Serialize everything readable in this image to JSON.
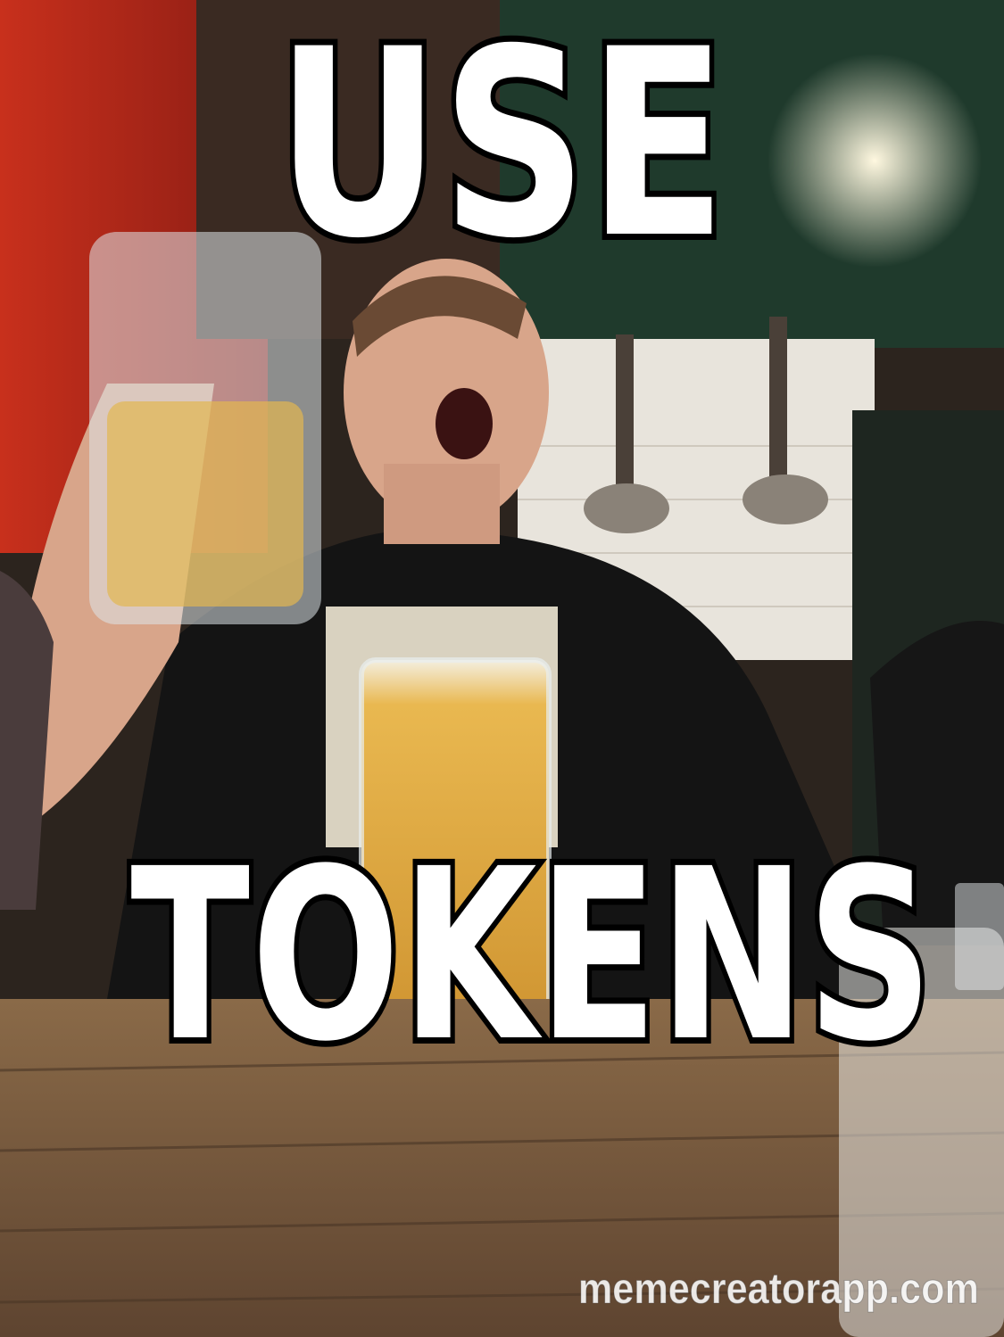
{
  "meme": {
    "top_text": "USE",
    "bottom_text": "TOKENS",
    "watermark": "memecreatorapp.com"
  }
}
